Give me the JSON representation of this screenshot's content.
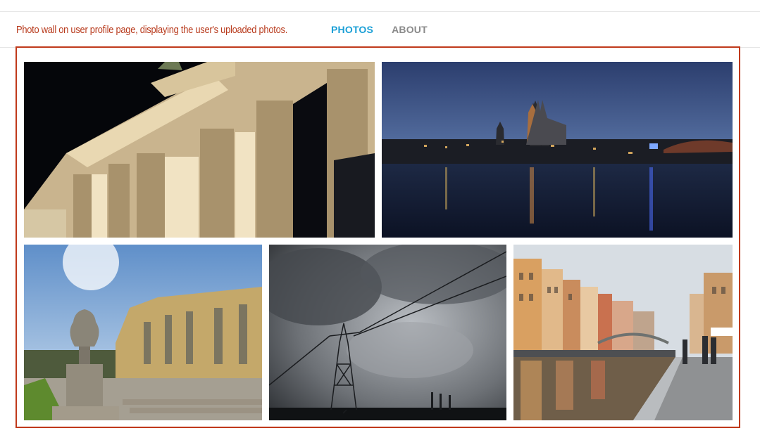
{
  "annotation": {
    "caption": "Photo wall on user profile page, displaying the user's uploaded photos.",
    "highlight_color": "#c0391b"
  },
  "nav": {
    "tabs": [
      {
        "label": "PHOTOS",
        "active": true
      },
      {
        "label": "ABOUT",
        "active": false
      }
    ],
    "active_color": "#1a9fd6"
  },
  "photos": [
    {
      "subject": "Brandenburg Gate at night"
    },
    {
      "subject": "City skyline with cathedral at dusk over river"
    },
    {
      "subject": "Palace with stone urn under sunny sky"
    },
    {
      "subject": "Storm clouds over power pylon"
    },
    {
      "subject": "Canal with colorful buildings and reflections"
    }
  ]
}
